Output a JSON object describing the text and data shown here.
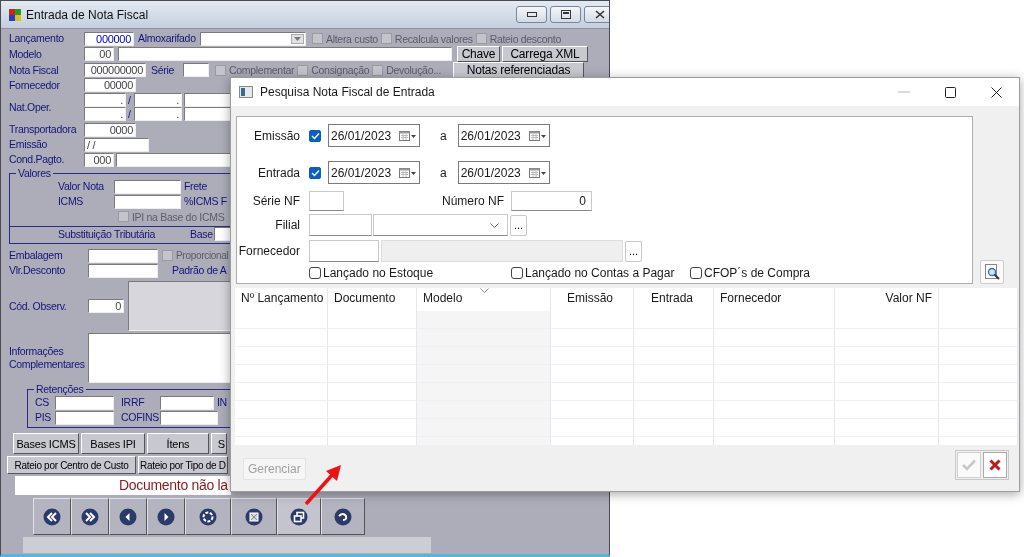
{
  "main_window": {
    "title": "Entrada de Nota Fiscal",
    "rows": [
      {
        "items": [
          {
            "kind": "label",
            "text": "Lançamento"
          },
          {
            "kind": "field",
            "value": "000000"
          },
          {
            "kind": "label",
            "text": "Almoxarifado"
          },
          {
            "kind": "combo"
          },
          {
            "kind": "checkbox",
            "label": "Altera custo",
            "checked": false,
            "disabled": true
          },
          {
            "kind": "checkbox",
            "label": "Recalcula valores",
            "checked": false,
            "disabled": true
          },
          {
            "kind": "checkbox",
            "label": "Rateio desconto",
            "checked": false,
            "disabled": true
          }
        ]
      },
      {
        "items": [
          {
            "kind": "label",
            "text": "Modelo"
          },
          {
            "kind": "field",
            "value": "00"
          },
          {
            "kind": "field"
          },
          {
            "kind": "button",
            "label": "Chave"
          },
          {
            "kind": "button",
            "label": "Carrega XML"
          }
        ]
      },
      {
        "items": [
          {
            "kind": "label",
            "text": "Nota Fiscal"
          },
          {
            "kind": "field",
            "value": "000000000"
          },
          {
            "kind": "label",
            "text": "Série"
          },
          {
            "kind": "field"
          },
          {
            "kind": "checkbox",
            "label": "Complementar",
            "checked": false,
            "disabled": true
          },
          {
            "kind": "checkbox",
            "label": "Consignação",
            "checked": false,
            "disabled": true
          },
          {
            "kind": "checkbox",
            "label": "Devolução...",
            "checked": false,
            "disabled": true
          },
          {
            "kind": "button",
            "label": "Notas referenciadas"
          }
        ]
      },
      {
        "items": [
          {
            "kind": "label",
            "text": "Fornecedor"
          },
          {
            "kind": "field",
            "value": "00000"
          }
        ]
      },
      {
        "items": [
          {
            "kind": "label",
            "text": "Nat.Oper."
          },
          {
            "kind": "stack",
            "rows": [
              {
                "items": [
                  {
                    "kind": "field",
                    "value": "."
                  },
                  {
                    "kind": "label",
                    "text": "/"
                  },
                  {
                    "kind": "field",
                    "value": "."
                  },
                  {
                    "kind": "field"
                  }
                ]
              },
              {
                "items": [
                  {
                    "kind": "field",
                    "value": "."
                  },
                  {
                    "kind": "label",
                    "text": "/"
                  },
                  {
                    "kind": "field",
                    "value": "."
                  },
                  {
                    "kind": "field"
                  }
                ]
              }
            ]
          }
        ]
      },
      {
        "items": [
          {
            "kind": "label",
            "text": "Transportadora"
          },
          {
            "kind": "field",
            "value": "0000"
          }
        ]
      },
      {
        "items": [
          {
            "kind": "label",
            "text": "Emissão"
          },
          {
            "kind": "field",
            "value": "/ /"
          }
        ]
      },
      {
        "items": [
          {
            "kind": "label",
            "text": "Cond.Pagto."
          },
          {
            "kind": "field",
            "value": "000"
          },
          {
            "kind": "field"
          }
        ]
      },
      {
        "kind": "group",
        "legend": "Valores",
        "rows": [
          {
            "items": [
              {
                "kind": "label",
                "text": "Valor Nota"
              },
              {
                "kind": "field"
              },
              {
                "kind": "label",
                "text": "Frete"
              }
            ]
          },
          {
            "items": [
              {
                "kind": "label",
                "text": "ICMS"
              },
              {
                "kind": "field"
              },
              {
                "kind": "label",
                "text": "%ICMS F"
              }
            ]
          },
          {
            "items": [
              {
                "kind": "checkbox",
                "label": "IPI na Base do ICMS",
                "checked": false,
                "disabled": true
              }
            ]
          },
          {
            "items": [
              {
                "kind": "label",
                "text": "Substituição Tributária"
              },
              {
                "kind": "label",
                "text": "Base"
              },
              {
                "kind": "field"
              }
            ]
          }
        ]
      },
      {
        "items": [
          {
            "kind": "label",
            "text": "Embalagem"
          },
          {
            "kind": "field"
          },
          {
            "kind": "checkbox",
            "label": "Proporcional",
            "checked": false,
            "disabled": true
          }
        ]
      },
      {
        "items": [
          {
            "kind": "label",
            "text": "Vlr.Desconto"
          },
          {
            "kind": "field"
          },
          {
            "kind": "label",
            "text": "Padrão de A"
          }
        ]
      },
      {
        "items": [
          {
            "kind": "label",
            "text": "Cód. Observ."
          },
          {
            "kind": "field",
            "value": "0"
          },
          {
            "kind": "memo",
            "disabled": true
          }
        ]
      },
      {
        "items": [
          {
            "kind": "label",
            "text": "Informações Complementares"
          },
          {
            "kind": "memo",
            "disabled": false
          }
        ]
      },
      {
        "kind": "group",
        "legend": "Retenções",
        "rows": [
          {
            "items": [
              {
                "kind": "label",
                "text": "CS"
              },
              {
                "kind": "field"
              },
              {
                "kind": "label",
                "text": "IRRF"
              },
              {
                "kind": "field"
              },
              {
                "kind": "label",
                "text": "IN"
              }
            ]
          },
          {
            "items": [
              {
                "kind": "label",
                "text": "PIS"
              },
              {
                "kind": "field"
              },
              {
                "kind": "label",
                "text": "COFINS"
              },
              {
                "kind": "field"
              }
            ]
          }
        ]
      },
      {
        "items": [
          {
            "kind": "button",
            "label": "Bases ICMS"
          },
          {
            "kind": "button",
            "label": "Bases IPI"
          },
          {
            "kind": "button",
            "label": "Ítens"
          },
          {
            "kind": "button",
            "label": "S"
          }
        ]
      },
      {
        "items": [
          {
            "kind": "button",
            "label": "Rateio por Centro de Custo"
          },
          {
            "kind": "button",
            "label": "Rateio por Tipo de D"
          }
        ]
      },
      {
        "items": [
          {
            "kind": "message",
            "text": "Documento não la"
          }
        ]
      }
    ],
    "toolbar": [
      {
        "kind": "first"
      },
      {
        "kind": "last"
      },
      {
        "kind": "previous"
      },
      {
        "kind": "next"
      },
      {
        "kind": "ring"
      },
      {
        "kind": "square"
      },
      {
        "kind": "windows"
      },
      {
        "kind": "undo"
      }
    ]
  },
  "dialog": {
    "title": "Pesquisa Nota Fiscal de Entrada",
    "date_filters": [
      {
        "label": "Emissão",
        "checked": true,
        "from": "26/01/2023",
        "separator": "a",
        "to": "26/01/2023"
      },
      {
        "label": "Entrada",
        "checked": true,
        "from": "26/01/2023",
        "separator": "a",
        "to": "26/01/2023"
      }
    ],
    "serie_nf": {
      "label": "Série NF"
    },
    "numero_nf": {
      "label": "Número NF",
      "value": "0"
    },
    "filial": {
      "label": "Filial",
      "lookup_button": "..."
    },
    "fornecedor": {
      "label": "Fornecedor",
      "lookup_button": "..."
    },
    "options": [
      {
        "label": "Lançado no Estoque",
        "checked": false
      },
      {
        "label": "Lançado no Contas a Pagar",
        "checked": false
      },
      {
        "label": "CFOP´s de Compra",
        "checked": false
      }
    ],
    "table": {
      "columns": [
        {
          "label": "Nº Lançamento",
          "sorted": false
        },
        {
          "label": "Documento",
          "sorted": false
        },
        {
          "label": "Modelo",
          "sorted": true
        },
        {
          "label": "Emissão",
          "sorted": false
        },
        {
          "label": "Entrada",
          "sorted": false
        },
        {
          "label": "Fornecedor",
          "sorted": false
        },
        {
          "label": "Valor NF",
          "sorted": false
        }
      ]
    },
    "buttons": {
      "manage": {
        "label": "Gerenciar",
        "disabled": true
      },
      "confirm": {
        "disabled": true
      },
      "cancel": {
        "disabled": false
      }
    }
  },
  "annotation": {
    "kind": "arrow"
  }
}
